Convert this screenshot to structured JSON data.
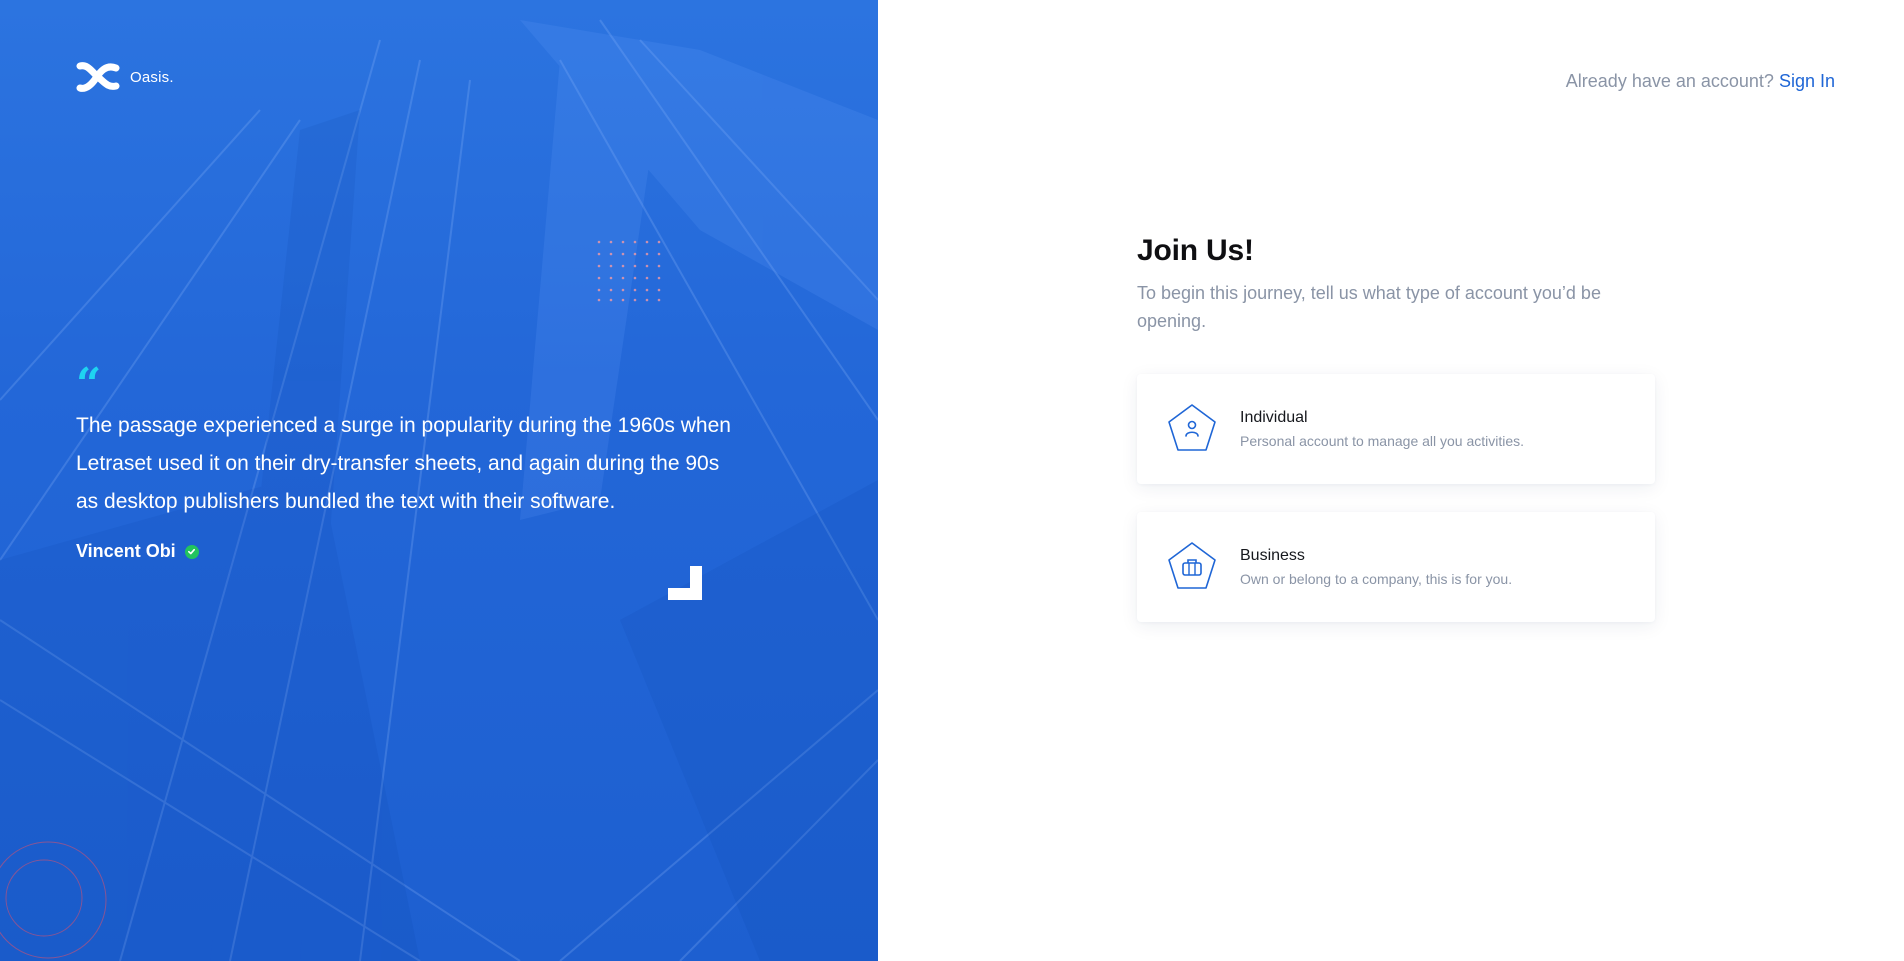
{
  "brand": {
    "name": "Oasis."
  },
  "hero": {
    "quote_mark": "“",
    "quote": "The passage experienced a surge in popularity during the 1960s when Letraset used it on their dry-transfer sheets, and again during the 90s as desktop publishers bundled the text with their software.",
    "author": "Vincent Obi"
  },
  "header": {
    "prompt": "Already have an account?",
    "signin_label": "Sign In"
  },
  "join": {
    "title": "Join Us!",
    "subtitle": "To begin this journey, tell us what type of account you’d be opening."
  },
  "account_types": [
    {
      "icon": "user-icon",
      "title": "Individual",
      "description": "Personal account to manage all you activities."
    },
    {
      "icon": "briefcase-icon",
      "title": "Business",
      "description": "Own or belong to a company, this is for you."
    }
  ],
  "colors": {
    "primary": "#1f66d6",
    "panel": "#2367d8",
    "quote_accent": "#1fd3f1",
    "verified": "#22c35e",
    "muted_text": "#8a94a6"
  }
}
